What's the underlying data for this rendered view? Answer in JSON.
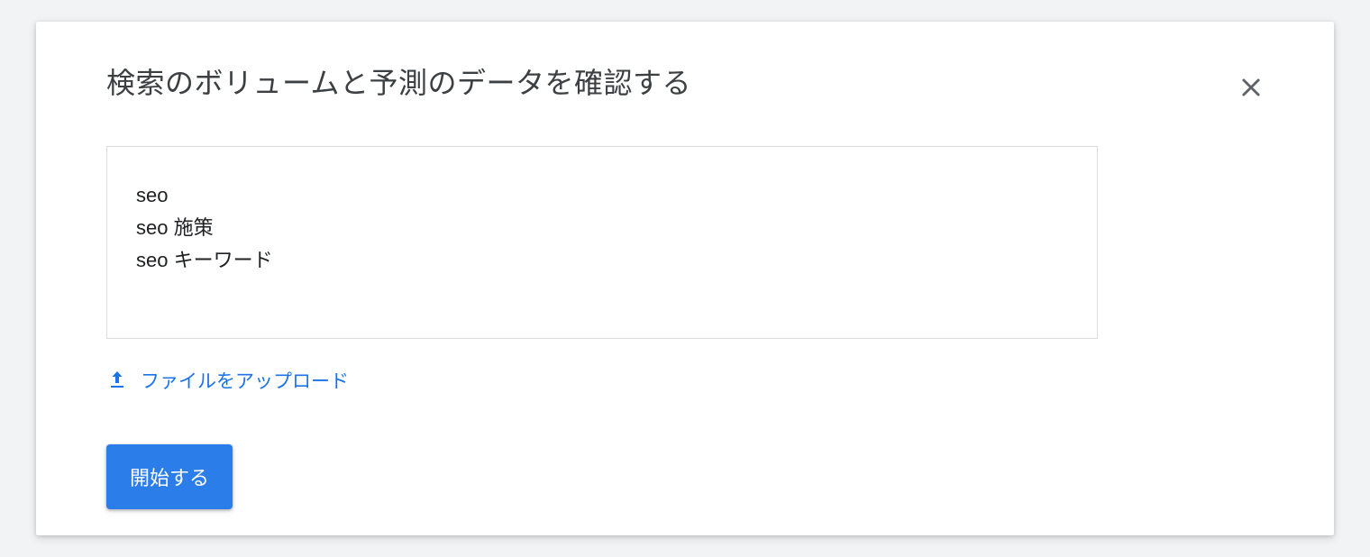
{
  "dialog": {
    "title": "検索のボリュームと予測のデータを確認する",
    "textarea_value": "seo\nseo 施策\nseo キーワード",
    "upload_label": "ファイルをアップロード",
    "start_label": "開始する"
  }
}
